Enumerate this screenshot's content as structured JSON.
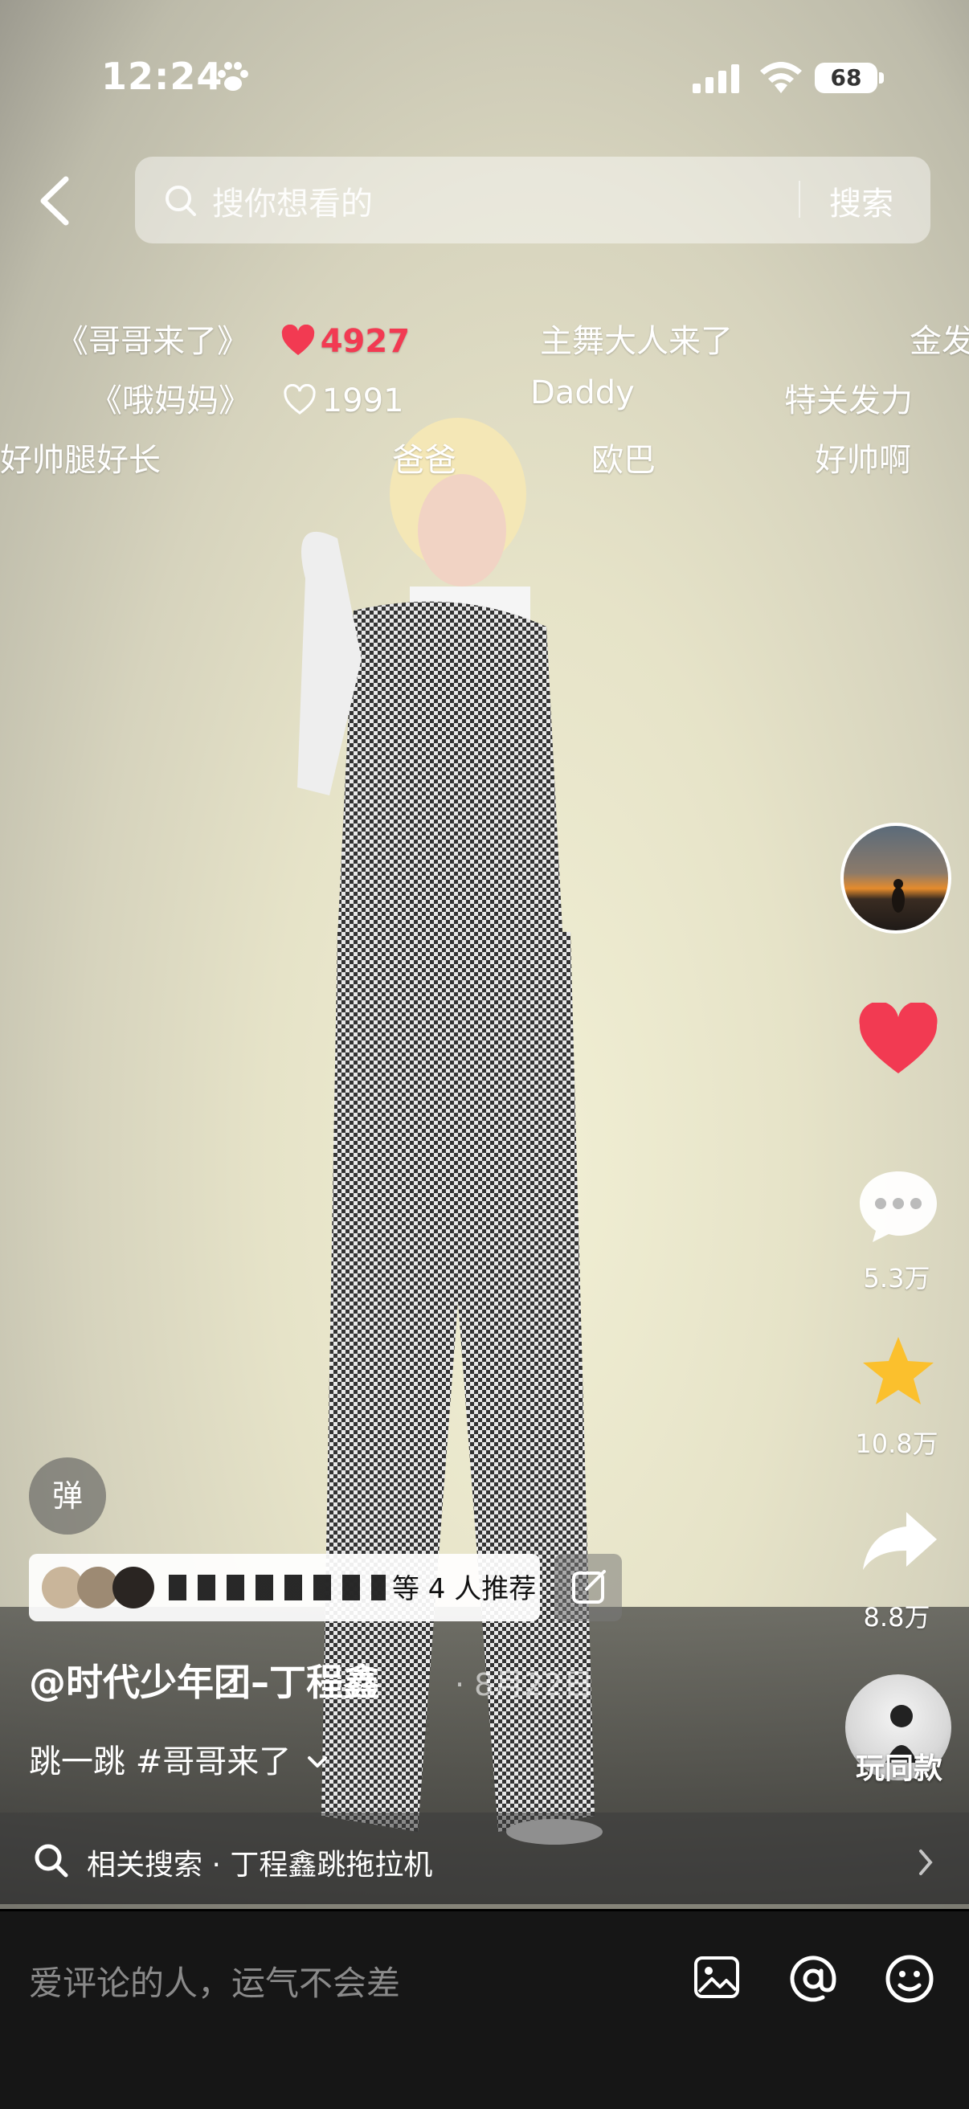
{
  "status_bar": {
    "time": "12:24",
    "battery": "68"
  },
  "search": {
    "placeholder": "搜你想看的",
    "button": "搜索"
  },
  "danmaku": [
    {
      "text": "《哥哥来了》",
      "likes": "4927",
      "liked": true
    },
    {
      "text": "主舞大人来了"
    },
    {
      "text": "金发"
    },
    {
      "text": "《哦妈妈》",
      "likes": "1991",
      "liked": false
    },
    {
      "text": "Daddy"
    },
    {
      "text": "特关发力"
    },
    {
      "text": "好帅腿好长"
    },
    {
      "text": "爸爸"
    },
    {
      "text": "欧巴"
    },
    {
      "text": "好帅啊"
    }
  ],
  "rail": {
    "comments": "5.3万",
    "favorites": "10.8万",
    "shares": "8.8万",
    "play_same": "玩同款"
  },
  "danmu_toggle": "弹",
  "recommend": {
    "text": "等 4 人推荐"
  },
  "author": "@时代少年团–丁程鑫",
  "date": "· 8月22日",
  "caption": "跳一跳 #哥哥来了",
  "related": {
    "label": "相关搜索 · 丁程鑫跳拖拉机"
  },
  "comment_bar": {
    "placeholder": "爱评论的人，运气不会差"
  },
  "colors": {
    "like": "#f23a52",
    "favorite": "#fbc02d"
  }
}
